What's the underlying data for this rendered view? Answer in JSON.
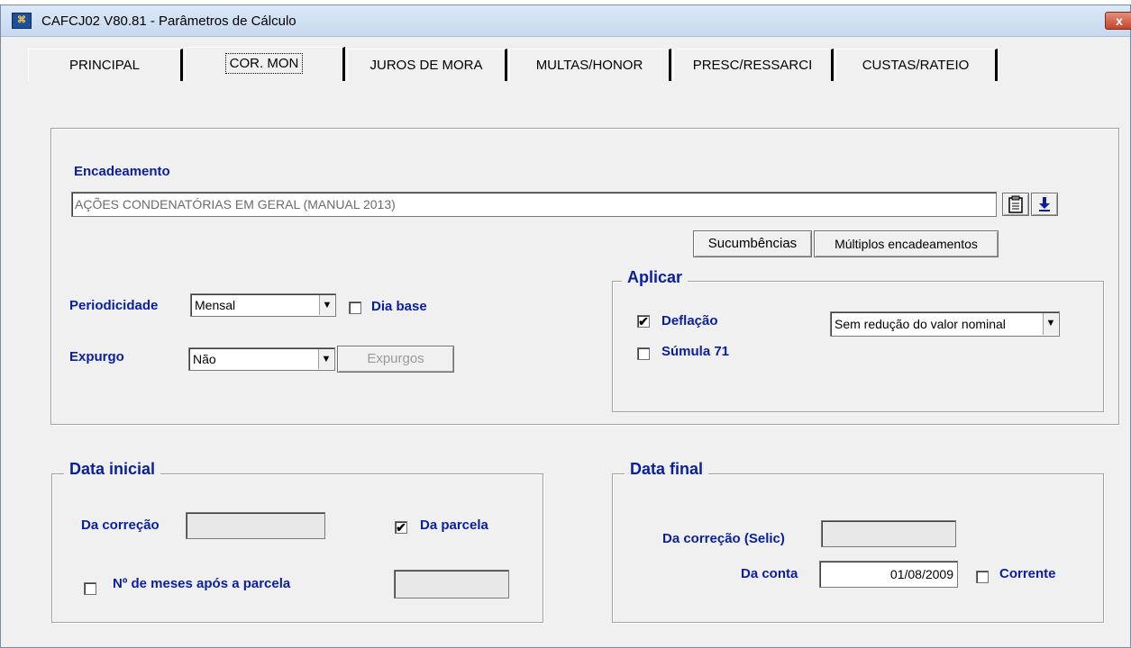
{
  "window": {
    "title": "CAFCJ02 V80.81 - Parâmetros de Cálculo",
    "close_label": "x"
  },
  "tabs": [
    {
      "label": "PRINCIPAL",
      "active": false
    },
    {
      "label": "COR. MON",
      "active": true
    },
    {
      "label": "JUROS DE MORA",
      "active": false
    },
    {
      "label": "MULTAS/HONOR",
      "active": false
    },
    {
      "label": "PRESC/RESSARCI",
      "active": false
    },
    {
      "label": "CUSTAS/RATEIO",
      "active": false
    }
  ],
  "encadeamento": {
    "label": "Encadeamento",
    "value": "AÇÕES CONDENATÓRIAS EM GERAL (MANUAL 2013)",
    "sucumbencias_button": "Sucumbências",
    "multiplos_button": "Múltiplos encadeamentos"
  },
  "periodicidade": {
    "label": "Periodicidade",
    "value": "Mensal",
    "dia_base_label": "Dia base",
    "dia_base_checked": false
  },
  "expurgo": {
    "label": "Expurgo",
    "value": "Não",
    "expurgos_button": "Expurgos"
  },
  "aplicar": {
    "legend": "Aplicar",
    "deflacao_label": "Deflação",
    "deflacao_checked": true,
    "deflacao_option": "Sem redução do valor nominal",
    "sumula_label": "Súmula 71",
    "sumula_checked": false
  },
  "data_inicial": {
    "legend": "Data inicial",
    "da_correcao_label": "Da correção",
    "da_correcao_value": "",
    "da_parcela_label": "Da parcela",
    "da_parcela_checked": true,
    "meses_label": "Nº de meses após a parcela",
    "meses_checked": false,
    "meses_value": ""
  },
  "data_final": {
    "legend": "Data final",
    "selic_label": "Da correção (Selic)",
    "selic_value": "",
    "da_conta_label": "Da conta",
    "da_conta_value": "01/08/2009",
    "corrente_label": "Corrente",
    "corrente_checked": false
  },
  "colors": {
    "label_blue": "#0a1f9e",
    "panel_bg": "#f0f0f0"
  }
}
